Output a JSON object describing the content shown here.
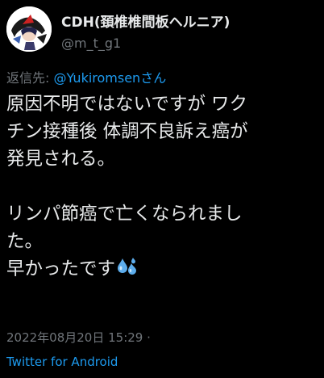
{
  "author": {
    "display_name": "CDH(頚椎椎間板ヘルニア)",
    "handle": "@m_t_g1",
    "avatar_icon": "character-avatar-icon"
  },
  "reply": {
    "prefix": "返信先: ",
    "mention": "@Yukiromsen",
    "honorific": "さん"
  },
  "tweet": {
    "lines": [
      "原因不明ではないですが ワク",
      "チン接種後 体調不良訴え癌が",
      "発見される。",
      "",
      "リンパ節癌で亡くなられまし",
      "た。",
      "早かったです"
    ],
    "emoji_icon": "sweat-droplets-icon"
  },
  "meta": {
    "timestamp": "2022年08月20日 15:29",
    "separator": " ·",
    "source": "Twitter for Android"
  },
  "colors": {
    "background": "#000000",
    "text": "#e7e9ea",
    "secondary": "#71767b",
    "link": "#1d9bf0"
  }
}
